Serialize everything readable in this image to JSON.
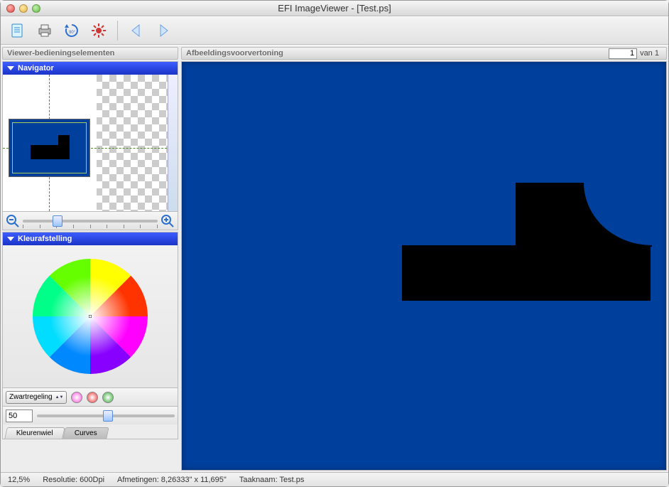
{
  "window": {
    "title": "EFI ImageViewer - [Test.ps]"
  },
  "sidebar": {
    "title": "Viewer-bedieningselementen",
    "navigator": {
      "label": "Navigator"
    },
    "kleur": {
      "label": "Kleurafstelling"
    },
    "zwart": {
      "label": "Zwartregeling"
    },
    "value": "50",
    "tabs": {
      "kleurenwiel": "Kleurenwiel",
      "curves": "Curves"
    }
  },
  "preview": {
    "title": "Afbeeldingsvoorvertoning",
    "page": "1",
    "van": "van",
    "total": "1"
  },
  "status": {
    "zoom": "12,5%",
    "res": "Resolutie: 600Dpi",
    "dim": "Afmetingen: 8,26333\" x 11,695\"",
    "task": "Taaknaam: Test.ps"
  }
}
